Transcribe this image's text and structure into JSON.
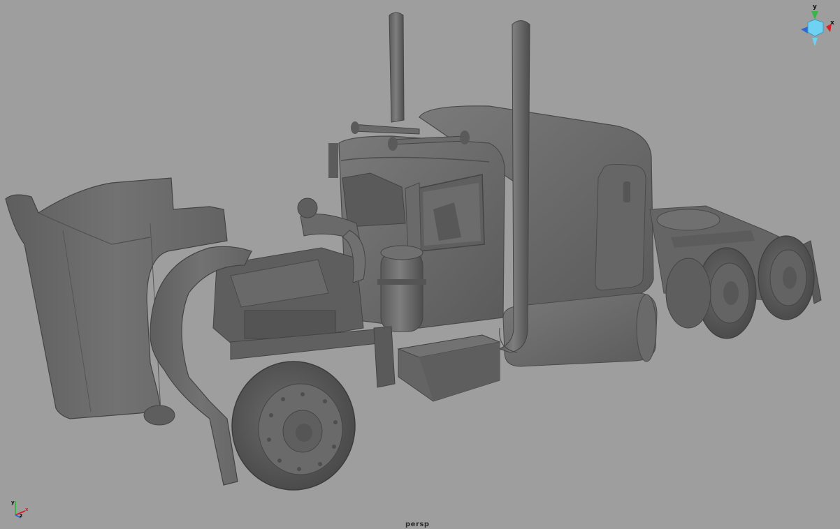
{
  "viewport": {
    "camera_name": "persp",
    "background_color": "#9e9e9e"
  },
  "scene": {
    "object": "semi-truck-model",
    "shading": "smooth-shaded",
    "model_color": "#6f6f6f"
  },
  "view_cube": {
    "axis_labels": {
      "y": "y",
      "x": "x"
    },
    "colors": {
      "y": "#39b54a",
      "x": "#d9202a",
      "z": "#2d6ad1",
      "center": "#6fd2f2"
    }
  },
  "origin_axis": {
    "axis_labels": {
      "y": "y",
      "x": "x",
      "z": "z"
    }
  }
}
